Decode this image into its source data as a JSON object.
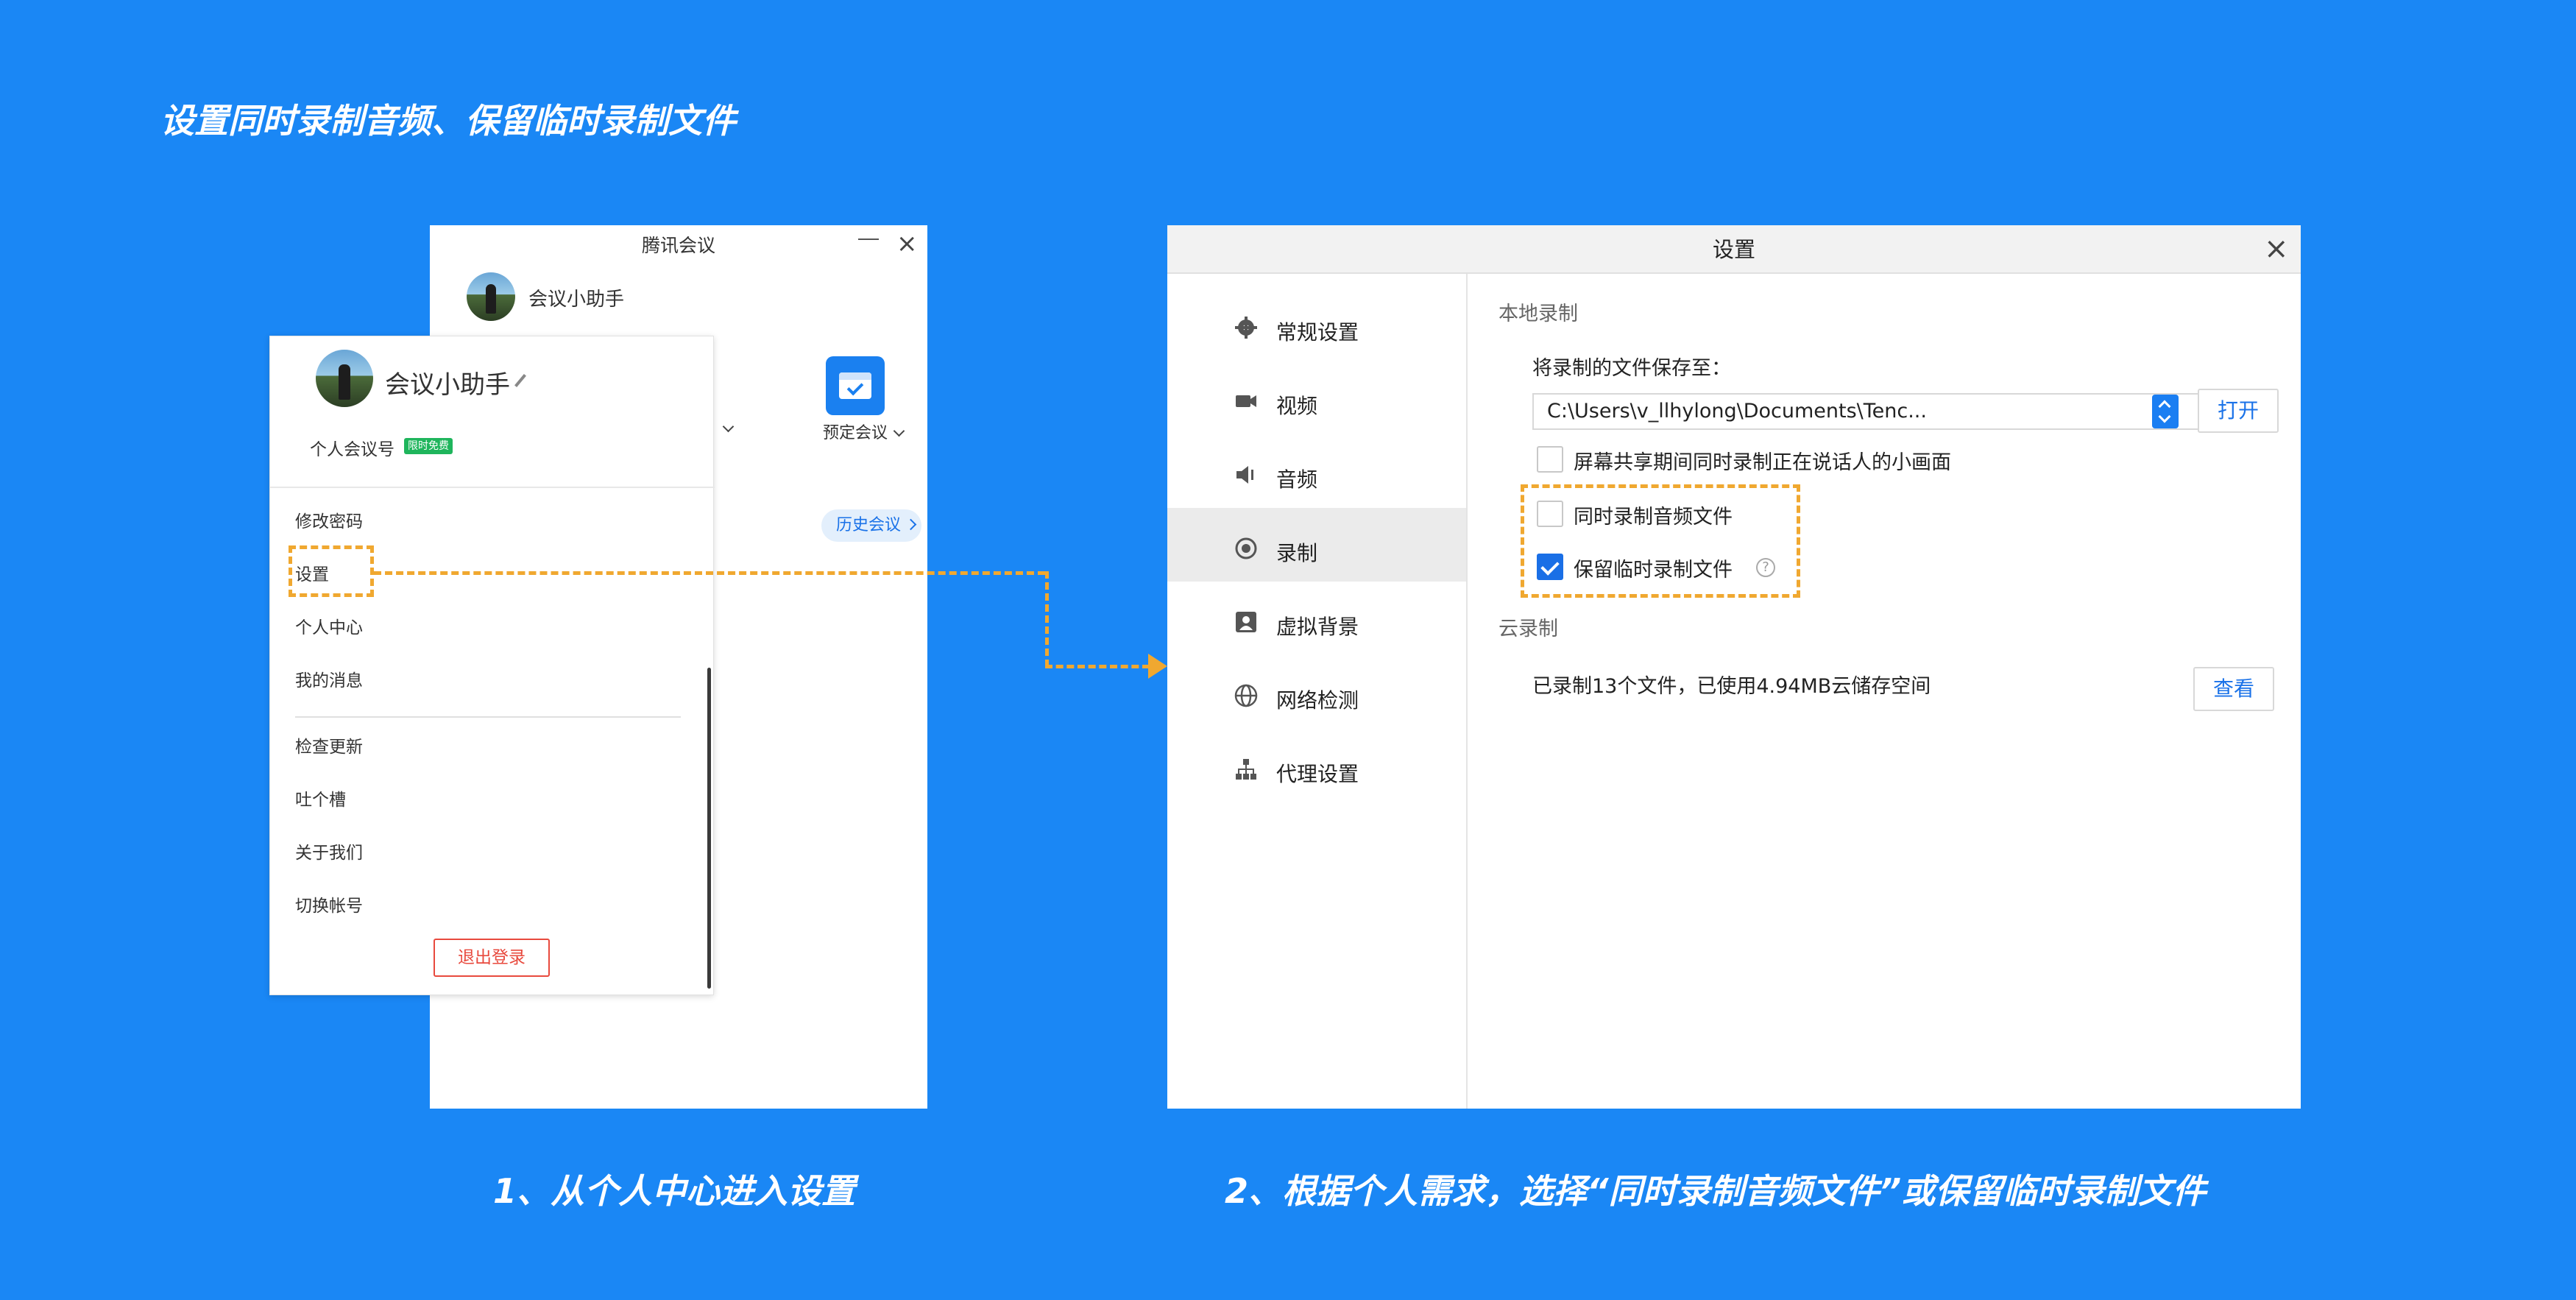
{
  "heading": "设置同时录制音频、保留临时录制文件",
  "captions": {
    "step1": "1、从个人中心进入设置",
    "step2": "2、根据个人需求，选择“同时录制音频文件”或保留临时录制文件"
  },
  "main_window": {
    "title": "腾讯会议",
    "user_name": "会议小助手",
    "schedule_label": "预定会议",
    "history_label": "历史会议"
  },
  "profile_menu": {
    "user_name": "会议小助手",
    "meeting_id_label": "个人会议号",
    "badge": "限时免费",
    "items": [
      "修改密码",
      "设置",
      "个人中心",
      "我的消息",
      "检查更新",
      "吐个槽",
      "关于我们",
      "切换帐号"
    ],
    "logout_label": "退出登录"
  },
  "settings_window": {
    "title": "设置",
    "sidebar": [
      {
        "label": "常规设置",
        "icon": "gear-icon"
      },
      {
        "label": "视频",
        "icon": "camera-icon"
      },
      {
        "label": "音频",
        "icon": "speaker-icon"
      },
      {
        "label": "录制",
        "icon": "record-icon",
        "active": true
      },
      {
        "label": "虚拟背景",
        "icon": "portrait-icon"
      },
      {
        "label": "网络检测",
        "icon": "globe-icon"
      },
      {
        "label": "代理设置",
        "icon": "network-icon"
      }
    ],
    "local": {
      "section_title": "本地录制",
      "save_label": "将录制的文件保存至：",
      "path": "C:\\Users\\v_llhylong\\Documents\\Tenc...",
      "open_label": "打开",
      "options": [
        {
          "label": "屏幕共享期间同时录制正在说话人的小画面",
          "checked": false
        },
        {
          "label": "同时录制音频文件",
          "checked": false
        },
        {
          "label": "保留临时录制文件",
          "checked": true
        }
      ]
    },
    "cloud": {
      "section_title": "云录制",
      "summary": "已录制13个文件，已使用4.94MB云储存空间",
      "view_label": "查看"
    }
  },
  "colors": {
    "background": "#1a87f5",
    "highlight": "#f0a830",
    "accent": "#1a6fe6",
    "logout": "#e84a3e"
  }
}
